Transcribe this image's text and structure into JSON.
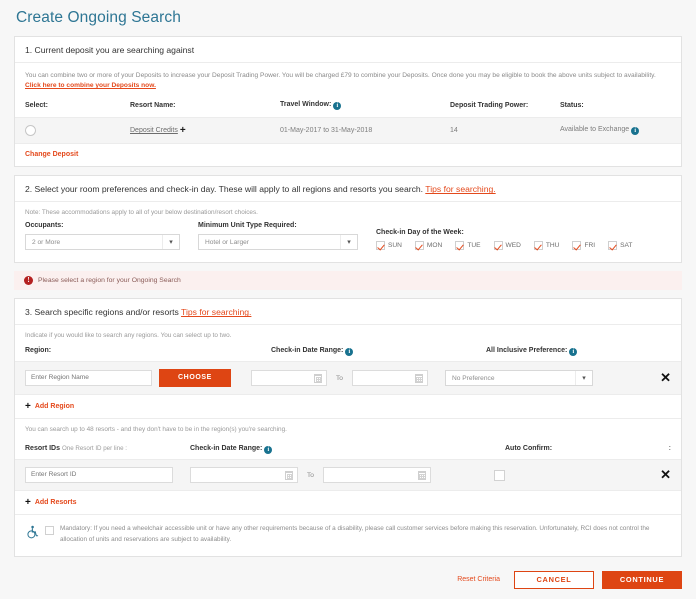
{
  "page": {
    "title": "Create Ongoing Search",
    "accent_orange": "#de4513",
    "accent_teal": "#2e7694",
    "error_red": "#b42020"
  },
  "section1": {
    "heading": "1. Current deposit you are searching against",
    "intro_text": "You can combine two or more of your Deposits to increase your Deposit Trading Power. You will be charged £79 to combine your Deposits. Once done you may be eligible to book the above units subject to availability. ",
    "intro_link": "Click here to combine your Deposits now.",
    "columns": {
      "select": "Select:",
      "resort_name": "Resort Name:",
      "travel_window": "Travel Window:",
      "trading_power": "Deposit Trading Power:",
      "status": "Status:"
    },
    "row": {
      "resort_name": "Deposit Credits",
      "travel_window": "01-May-2017 to 31-May-2018",
      "trading_power": "14",
      "status": "Available to Exchange"
    },
    "change_deposit_label": "Change Deposit"
  },
  "section2": {
    "heading": "2. Select your room preferences and check-in day. These will apply to all regions and resorts you search. ",
    "heading_link": "Tips for searching.",
    "note": "Note: These accommodations apply to all of your below destination/resort choices.",
    "occupants_label": "Occupants:",
    "occupants_value": "2 or More",
    "unit_type_label": "Minimum Unit Type Required:",
    "unit_type_value": "Hotel or Larger",
    "checkin_day_label": "Check-in Day of the Week:",
    "days": [
      {
        "label": "SUN",
        "checked": true
      },
      {
        "label": "MON",
        "checked": true
      },
      {
        "label": "TUE",
        "checked": true
      },
      {
        "label": "WED",
        "checked": true
      },
      {
        "label": "THU",
        "checked": true
      },
      {
        "label": "FRI",
        "checked": true
      },
      {
        "label": "SAT",
        "checked": true
      }
    ]
  },
  "error": {
    "message": "Please select a region for your Ongoing Search",
    "icon": "!"
  },
  "section3": {
    "heading": "3. Search specific regions and/or resorts ",
    "heading_link": "Tips for searching.",
    "region_note": "Indicate if you would like to search any regions. You can select up to two.",
    "region_label": "Region:",
    "checkin_range_label": "Check-in Date Range:",
    "all_inclusive_label": "All Inclusive Preference:",
    "region_placeholder": "Enter Region Name",
    "choose_button": "CHOOSE",
    "to_label": "To",
    "all_inclusive_value": "No Preference",
    "add_region_label": "Add Region",
    "resorts_note": "You can search up to 48 resorts - and they don't have to be in the region(s) you're searching.",
    "resort_ids_label": "Resort IDs",
    "resort_ids_sub": "One Resort ID per line :",
    "resort_checkin_label": "Check-in Date Range:",
    "auto_confirm_label": "Auto Confirm:",
    "kebab": ":",
    "resort_placeholder": "Enter Resort ID",
    "resort_to_label": "To",
    "add_resorts_label": "Add Resorts"
  },
  "mandatory": {
    "text": "Mandatory: If you need a wheelchair accessible unit or have any other requirements because of a disability, please call customer services before making this reservation.  Unfortunately, RCI does not control the allocation of units and reservations are subject to availability."
  },
  "footer": {
    "reset_label": "Reset Criteria",
    "cancel_label": "CANCEL",
    "continue_label": "CONTINUE"
  }
}
